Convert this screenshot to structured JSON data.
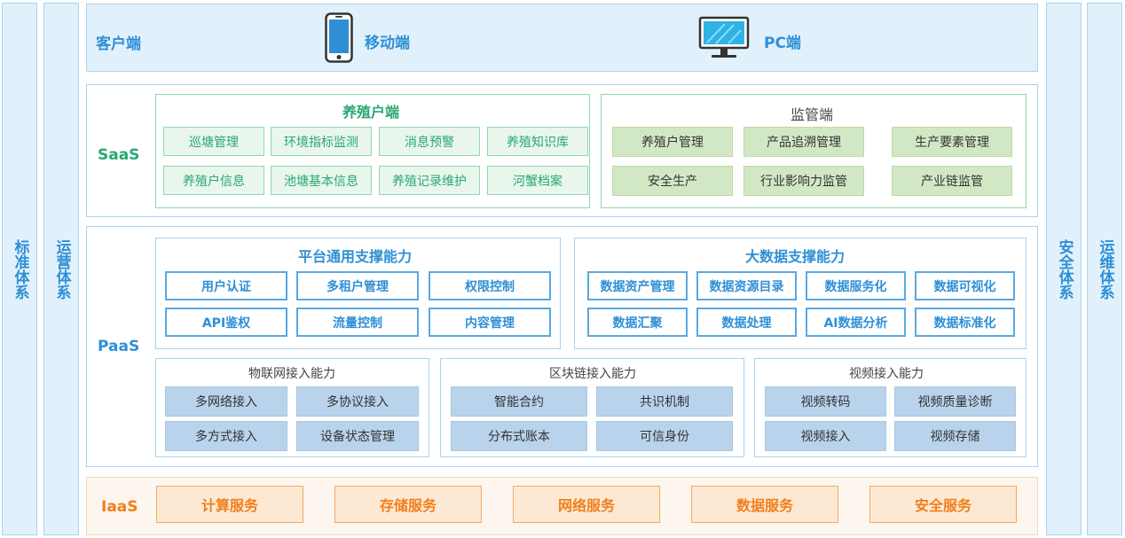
{
  "side_bars": {
    "left_outer": "标准体系",
    "left_inner": "运营体系",
    "right_inner": "安全体系",
    "right_outer": "运维体系"
  },
  "client": {
    "label": "客户端",
    "mobile_label": "移动端",
    "pc_label": "PC端",
    "mobile_icon": "smartphone-icon",
    "pc_icon": "monitor-icon"
  },
  "saas": {
    "label": "SaaS",
    "farmer": {
      "title": "养殖户端",
      "items": [
        "巡塘管理",
        "环境指标监测",
        "消息预警",
        "养殖知识库",
        "养殖户信息",
        "池塘基本信息",
        "养殖记录维护",
        "河蟹档案"
      ]
    },
    "regulator": {
      "title": "监管端",
      "items": [
        "养殖户管理",
        "产品追溯管理",
        "生产要素管理",
        "安全生产",
        "行业影响力监管",
        "产业链监管"
      ]
    }
  },
  "paas": {
    "label": "PaaS",
    "platform": {
      "title": "平台通用支撑能力",
      "items": [
        "用户认证",
        "多租户管理",
        "权限控制",
        "API鉴权",
        "流量控制",
        "内容管理"
      ]
    },
    "bigdata": {
      "title": "大数据支撑能力",
      "items": [
        "数据资产管理",
        "数据资源目录",
        "数据服务化",
        "数据可视化",
        "数据汇聚",
        "数据处理",
        "AI数据分析",
        "数据标准化"
      ]
    },
    "iot": {
      "title": "物联网接入能力",
      "items": [
        "多网络接入",
        "多协议接入",
        "多方式接入",
        "设备状态管理"
      ]
    },
    "blockchain": {
      "title": "区块链接入能力",
      "items": [
        "智能合约",
        "共识机制",
        "分布式账本",
        "可信身份"
      ]
    },
    "video": {
      "title": "视频接入能力",
      "items": [
        "视频转码",
        "视频质量诊断",
        "视频接入",
        "视频存储"
      ]
    }
  },
  "iaas": {
    "label": "IaaS",
    "items": [
      "计算服务",
      "存储服务",
      "网络服务",
      "数据服务",
      "安全服务"
    ]
  },
  "colors": {
    "blue_accent": "#2f8fd6",
    "green_accent": "#2aa773",
    "orange_accent": "#f07f1d",
    "panel_border": "#a9d3ee"
  }
}
